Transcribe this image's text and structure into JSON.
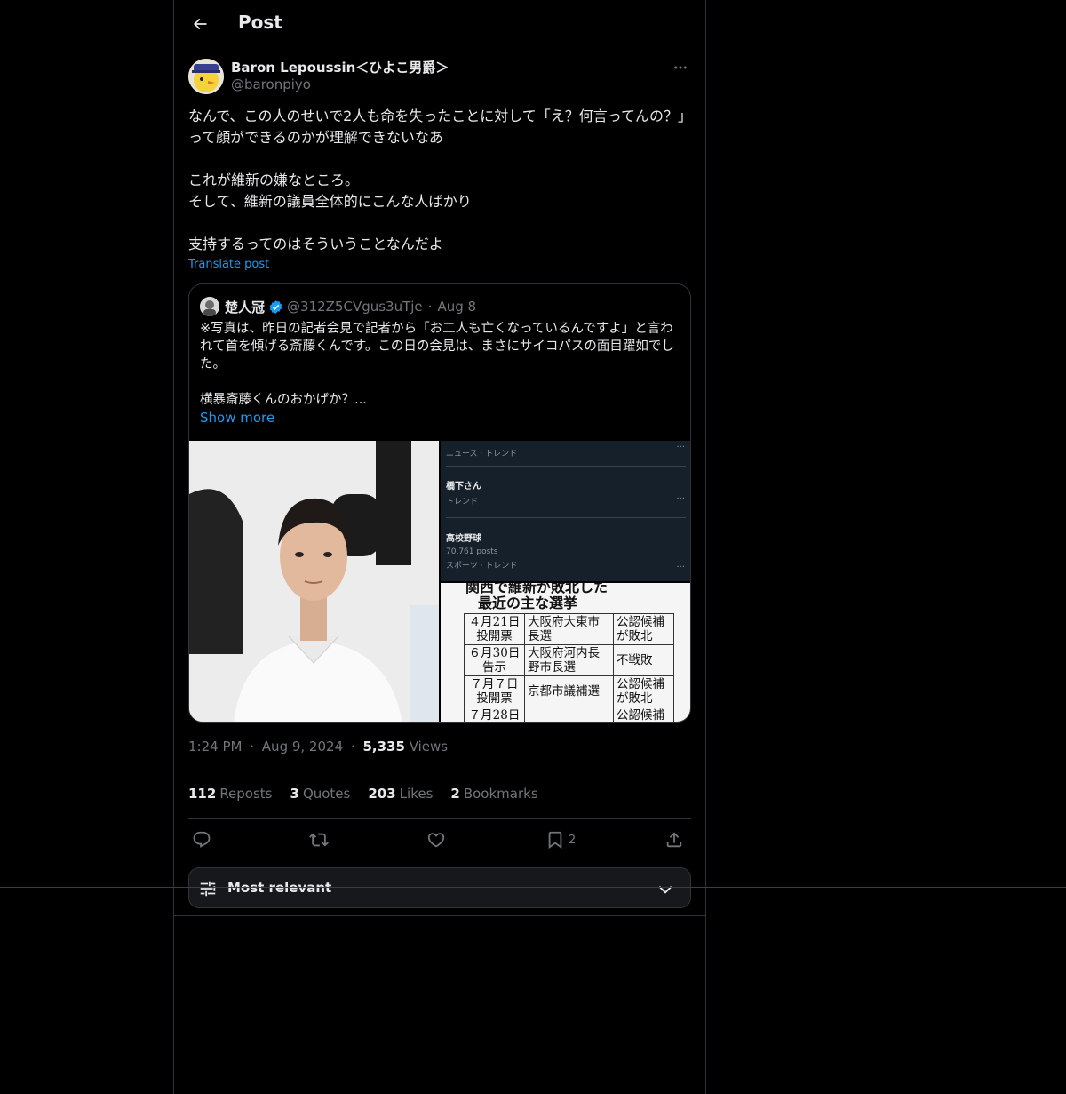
{
  "header": {
    "title": "Post"
  },
  "author": {
    "name": "Baron Lepoussin＜ひよこ男爵＞",
    "handle": "@baronpiyo"
  },
  "post": {
    "text": "なんで、この人のせいで2人も命を失ったことに対して「え？何言ってんの？」って顔ができるのかが理解できないなあ\n\nこれが維新の嫌なところ。\nそして、維新の議員全体的にこんな人ばかり\n\n支持するってのはそういうことなんだよ",
    "translate_label": "Translate post"
  },
  "quote": {
    "name": "楚人冠",
    "handle": "@312Z5CVgus3uTje",
    "dot": "·",
    "date": "Aug 8",
    "text": "※写真は、昨日の記者会見で記者から「お二人も亡くなっているんですよ」と言われて首を傾げる斎藤くんです。この日の会見は、まさにサイコパスの面目躍如でした。\n\n横暴斎藤くんのおかげか？...",
    "show_more": "Show more",
    "trend_panel": {
      "row1_small": "ニュース · トレンド",
      "row2_big": "橋下さん",
      "row2_small": "トレンド",
      "row3_big": "高校野球",
      "row3_posts": "70,761 posts",
      "row3_small": "スポーツ · トレンド"
    },
    "election_table": {
      "title_line1": "関西で維新が敗北した",
      "title_line2": "最近の主な選挙",
      "rows": [
        {
          "date": "４月21日\n投開票",
          "election": "大阪府大東市\n長選",
          "result": "公認候補\nが敗北"
        },
        {
          "date": "６月30日\n告示",
          "election": "大阪府河内長\n野市長選",
          "result": "不戦敗"
        },
        {
          "date": "７月７日\n投開票",
          "election": "京都市議補選",
          "result": "公認候補\nが敗北"
        },
        {
          "date": "７月28日",
          "election": "",
          "result": "公認候補"
        }
      ]
    }
  },
  "meta": {
    "time": "1:24 PM",
    "sep": "·",
    "date": "Aug 9, 2024",
    "views_count": "5,335",
    "views_label": "Views"
  },
  "stats": {
    "reposts_count": "112",
    "reposts_label": "Reposts",
    "quotes_count": "3",
    "quotes_label": "Quotes",
    "likes_count": "203",
    "likes_label": "Likes",
    "bookmarks_count": "2",
    "bookmarks_label": "Bookmarks"
  },
  "actions": {
    "bookmark_count": "2"
  },
  "sort": {
    "label": "Most relevant"
  },
  "colors": {
    "accent": "#1d9bf0",
    "muted": "#71767b",
    "text": "#e7e9ea",
    "background": "#000000",
    "border": "#2f3336"
  }
}
